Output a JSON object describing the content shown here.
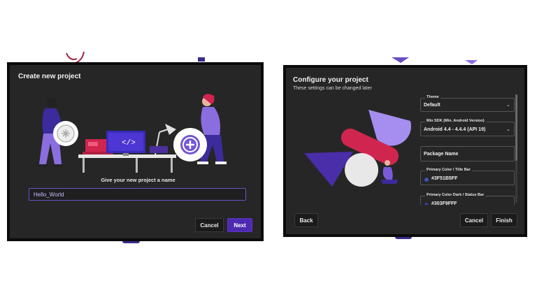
{
  "dialog1": {
    "title": "Create new project",
    "prompt": "Give your new project a name",
    "project_name_value": "Hello_World",
    "cancel_label": "Cancel",
    "next_label": "Next",
    "illustration": "team-building-project-illustration"
  },
  "dialog2": {
    "title": "Configure your project",
    "subtitle": "These settings can be changed later",
    "theme": {
      "label": "Theme",
      "value": "Default"
    },
    "min_sdk": {
      "label": "Min SDK (Min. Android Version)",
      "value": "Android 4.4 - 4.4.4 (API 19)"
    },
    "package_name": {
      "placeholder": "Package Name"
    },
    "primary_color": {
      "label": "Primary Color / Title Bar",
      "value": "#3F51B5FF",
      "color": "#3f51b5"
    },
    "primary_color_dark": {
      "label": "Primary Color Dark / Status Bar",
      "value": "#303F9FFF",
      "color": "#303f9f"
    },
    "back_label": "Back",
    "cancel_label": "Cancel",
    "finish_label": "Finish",
    "illustration": "geometric-shapes-illustration"
  },
  "colors": {
    "accent": "#4d2ab0",
    "dialog_bg": "#262626",
    "input_border": "#6a52c7"
  }
}
